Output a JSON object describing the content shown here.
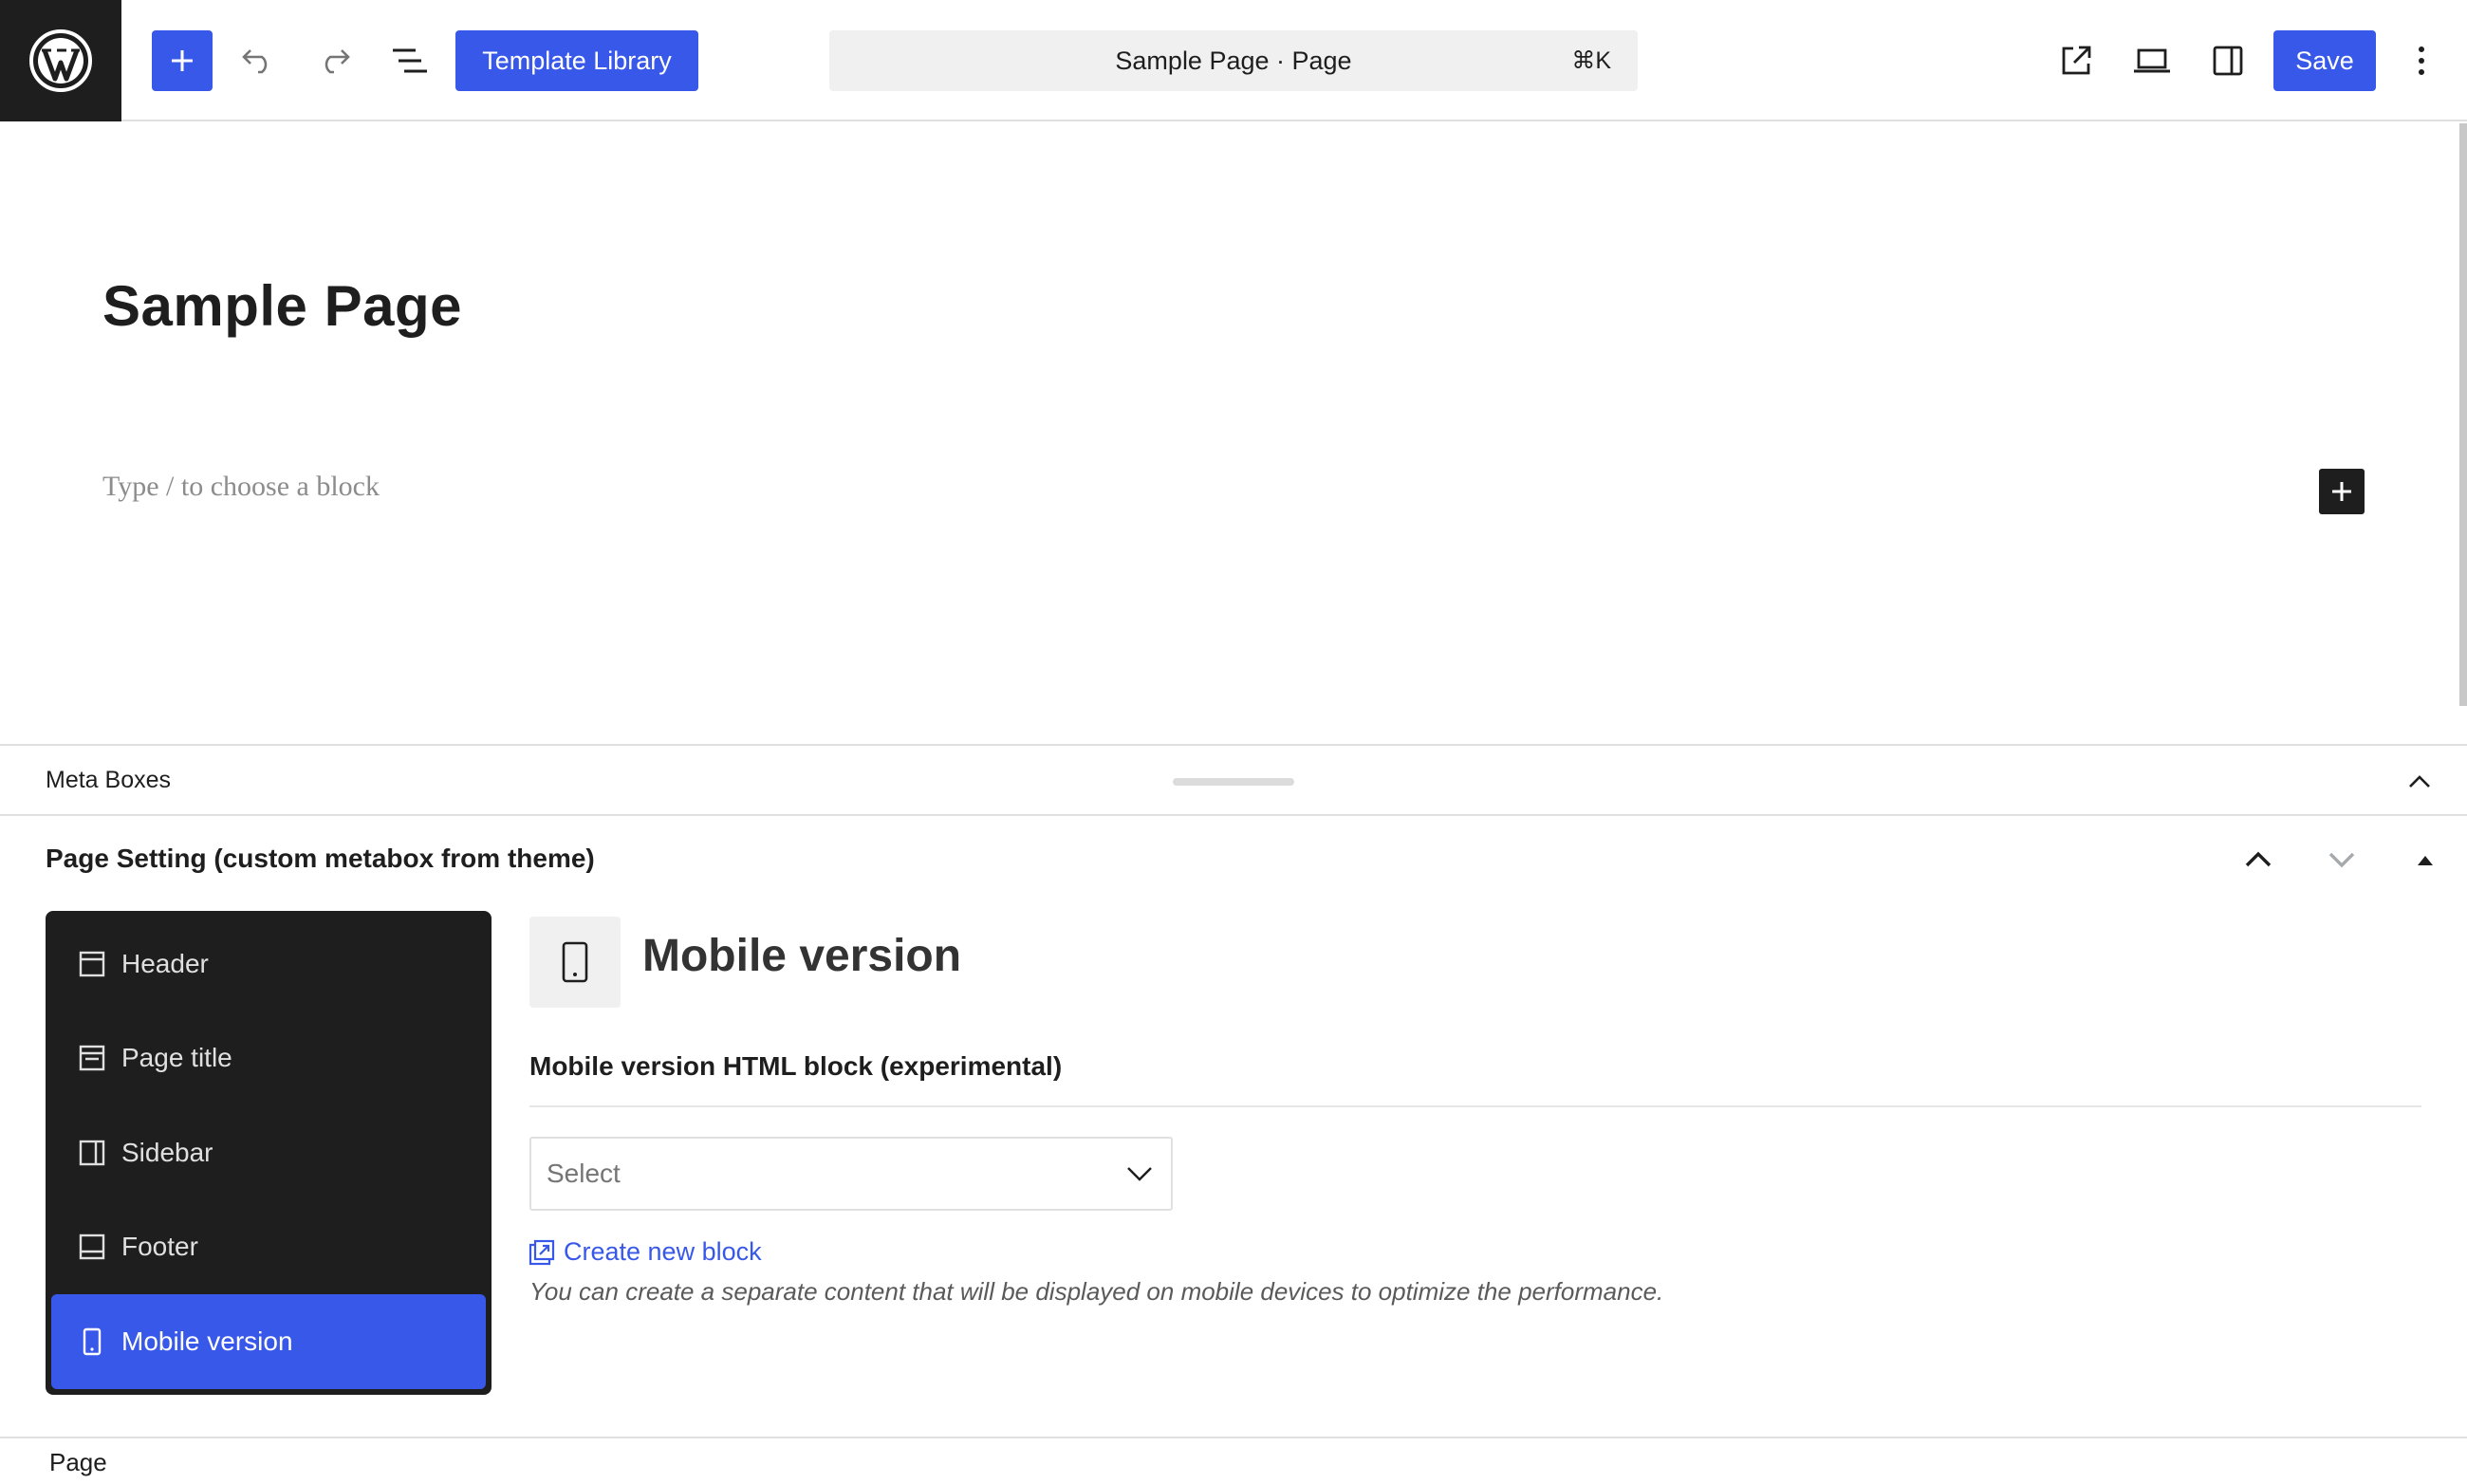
{
  "toolbar": {
    "logo": "wordpress-logo",
    "template_library_label": "Template Library",
    "document_title": "Sample Page · Page",
    "shortcut": "⌘K",
    "save_label": "Save"
  },
  "canvas": {
    "title": "Sample Page",
    "placeholder": "Type / to choose a block"
  },
  "meta_boxes": {
    "title": "Meta Boxes",
    "box_title": "Page Setting (custom metabox from theme)",
    "nav": [
      {
        "label": "Header",
        "icon": "header-icon"
      },
      {
        "label": "Page title",
        "icon": "page-title-icon"
      },
      {
        "label": "Sidebar",
        "icon": "sidebar-icon"
      },
      {
        "label": "Footer",
        "icon": "footer-icon"
      },
      {
        "label": "Mobile version",
        "icon": "mobile-icon",
        "active": true
      }
    ],
    "panel": {
      "heading": "Mobile version",
      "field_label": "Mobile version HTML block (experimental)",
      "select_value": "Select",
      "create_link": "Create new block",
      "help_text": "You can create a separate content that will be displayed on mobile devices to optimize the performance."
    }
  },
  "footer": {
    "breadcrumb": "Page"
  },
  "colors": {
    "accent": "#3858e9",
    "dark": "#1e1e1e",
    "border": "#e0e0e0"
  }
}
